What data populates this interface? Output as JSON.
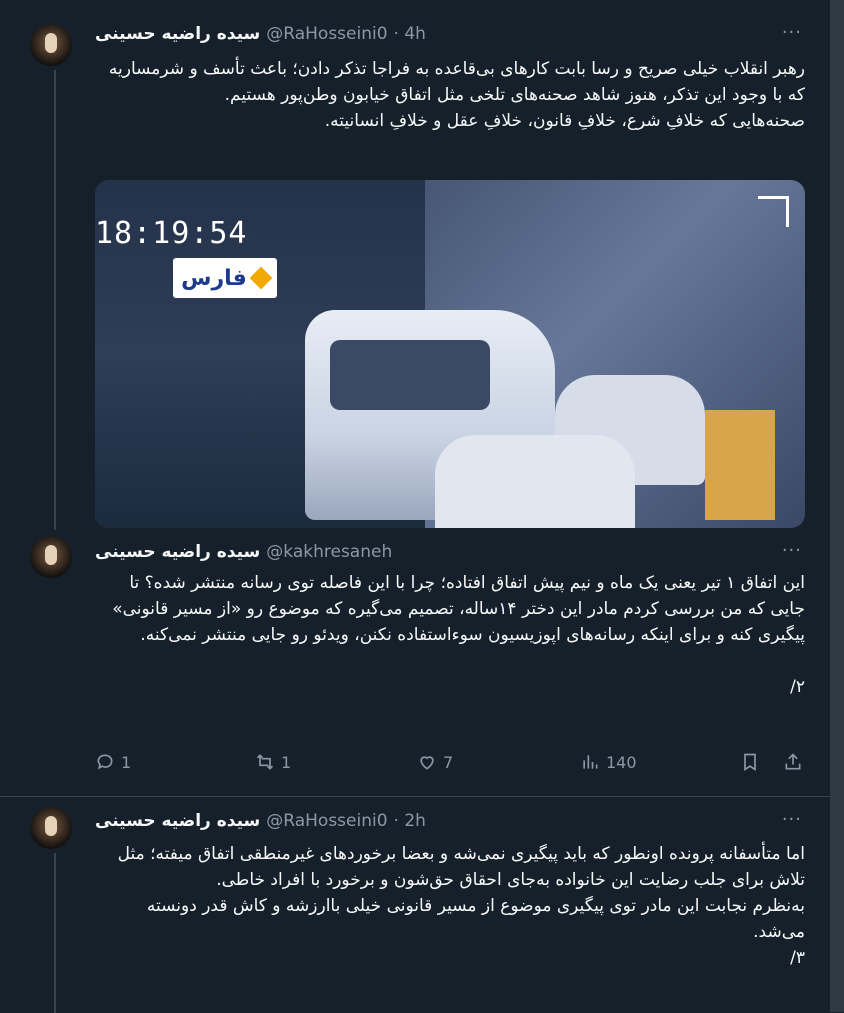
{
  "tweets": [
    {
      "name": "سیده راضیه حسینی",
      "handle": "@RaHosseini0",
      "time": "· 4h",
      "text": "رهبر انقلاب خیلی صریح و رسا بابت کارهای بی‌قاعده به فراجا تذکر دادن؛ باعث تأسف و شرمساریه که با وجود این تذکر، هنوز شاهد صحنه‌های تلخی مثل اتفاق خیابون وطن‌پور هستیم.\nصحنه‌هایی که خلافِ شرع، خلافِ قانون، خلافِ عقل و خلافِ انسانیته.",
      "media": {
        "timestamp": "18:19:54",
        "logo_text": "فارس"
      }
    },
    {
      "name": "سیده راضیه حسینی",
      "handle": "@kakhresaneh",
      "text": "این اتفاق ۱ تیر یعنی یک ماه و نیم پیش اتفاق افتاده؛ چرا با این فاصله توی رسانه منتشر شده؟ تا جایی که من بررسی کردم مادر این دختر ۱۴ساله، تصمیم می‌گیره که موضوع رو «از مسیر قانونی» پیگیری کنه و برای اینکه رسانه‌های اپوزیسیون سوءاستفاده نکنن، ویدئو رو جایی منتشر نمی‌کنه.\n\n۲/",
      "actions": {
        "replies": "1",
        "retweets": "1",
        "likes": "7",
        "views": "140"
      }
    },
    {
      "name": "سیده راضیه حسینی",
      "handle": "@RaHosseini0",
      "time": "· 2h",
      "text": "اما متأسفانه پرونده اونطور که باید پیگیری نمی‌شه و بعضا برخوردهای غیرمنطقی اتفاق میفته؛ مثل تلاش برای جلب رضایت این خانواده به‌جای احقاق حق‌شون و برخورد با افراد خاطی.\nبه‌نظرم نجابت این مادر توی پیگیری موضوع از مسیر قانونی خیلی باارزشه و کاش قدر دونسته می‌شد.\n۳/"
    }
  ],
  "more_label": "···"
}
